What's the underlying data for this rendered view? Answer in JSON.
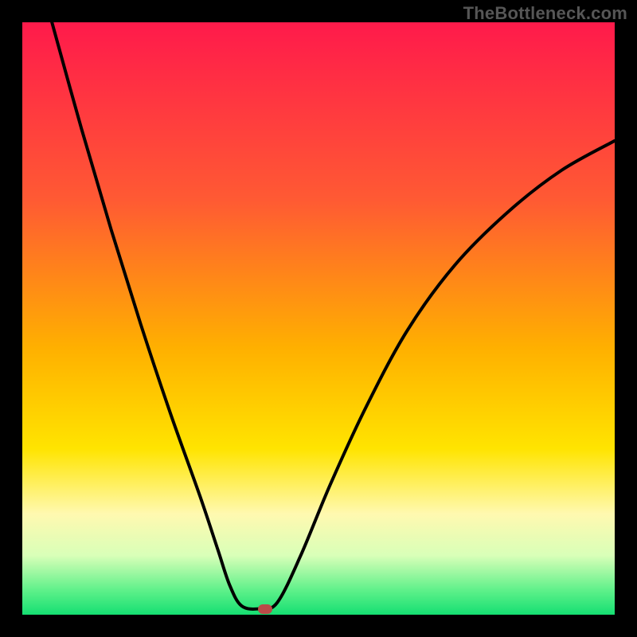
{
  "watermark": "TheBottleneck.com",
  "chart_data": {
    "type": "line",
    "title": "",
    "xlabel": "",
    "ylabel": "",
    "xlim": [
      0,
      100
    ],
    "ylim": [
      0,
      100
    ],
    "grid": false,
    "legend": false,
    "gradient_stops": [
      {
        "offset": 0,
        "color": "#ff1a4b"
      },
      {
        "offset": 30,
        "color": "#ff5a33"
      },
      {
        "offset": 55,
        "color": "#ffb000"
      },
      {
        "offset": 72,
        "color": "#ffe400"
      },
      {
        "offset": 83,
        "color": "#fff9b0"
      },
      {
        "offset": 90,
        "color": "#d9ffb8"
      },
      {
        "offset": 96,
        "color": "#5cf089"
      },
      {
        "offset": 100,
        "color": "#15df72"
      }
    ],
    "series": [
      {
        "name": "curve",
        "points": [
          {
            "x": 5,
            "y": 100
          },
          {
            "x": 10,
            "y": 82
          },
          {
            "x": 15,
            "y": 65
          },
          {
            "x": 20,
            "y": 49
          },
          {
            "x": 25,
            "y": 34
          },
          {
            "x": 30,
            "y": 20
          },
          {
            "x": 33,
            "y": 11
          },
          {
            "x": 35,
            "y": 5
          },
          {
            "x": 37,
            "y": 1.5
          },
          {
            "x": 40,
            "y": 1
          },
          {
            "x": 43,
            "y": 2
          },
          {
            "x": 47,
            "y": 10
          },
          {
            "x": 52,
            "y": 22
          },
          {
            "x": 58,
            "y": 35
          },
          {
            "x": 65,
            "y": 48
          },
          {
            "x": 73,
            "y": 59
          },
          {
            "x": 82,
            "y": 68
          },
          {
            "x": 91,
            "y": 75
          },
          {
            "x": 100,
            "y": 80
          }
        ]
      }
    ],
    "marker": {
      "x": 41,
      "y": 1
    }
  }
}
